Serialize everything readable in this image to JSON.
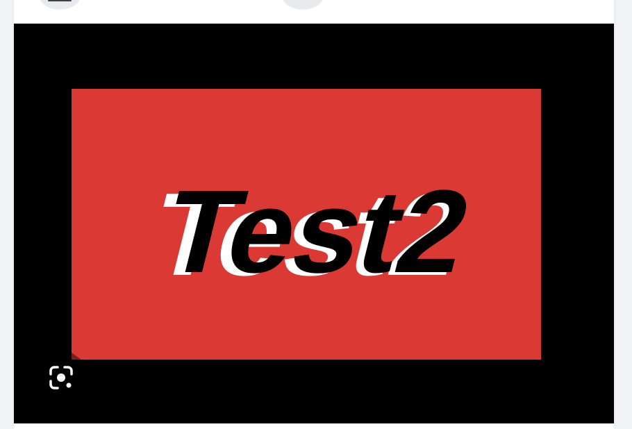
{
  "image": {
    "text": "Test2",
    "colors": {
      "background": "#000000",
      "panel": "#db3a34",
      "text": "#000000",
      "text_shadow": "#ffffff"
    }
  },
  "icons": {
    "top_left": "menu-icon",
    "top_right": "circle-button-icon",
    "lens": "google-lens-icon"
  }
}
